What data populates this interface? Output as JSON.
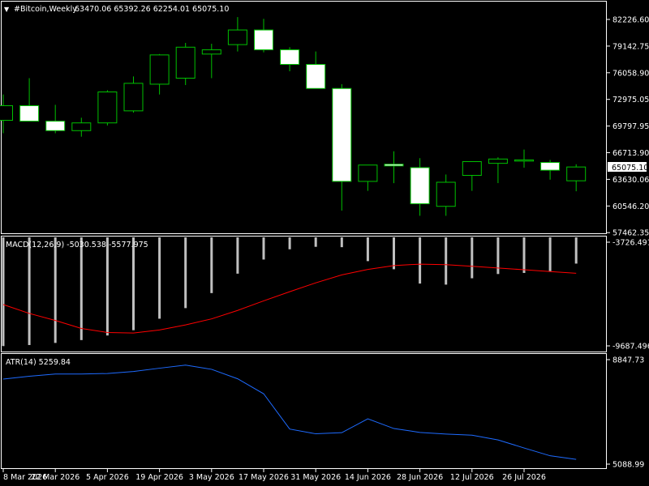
{
  "header": {
    "menu_arrow": "▼",
    "symbol": "#Bitcoin,Weekly",
    "ohlc": "63470.06 65392.26 62254.01 65075.10"
  },
  "macd_header": {
    "label": "MACD(12,26,9) -5030.538 -5577.975"
  },
  "atr_header": {
    "label": "ATR(14) 5259.84"
  },
  "current_price": "65075.10",
  "colors": {
    "background": "#000000",
    "frame": "#ffffff",
    "candle_outline": "#00c000",
    "bull_body": "#000000",
    "bear_body": "#ffffff",
    "macd_hist": "#c0c0c0",
    "macd_signal": "#ff0000",
    "atr_line": "#1e6bff",
    "axis_text": "#ffffff"
  },
  "chart_data": [
    {
      "type": "candlestick",
      "title": "#Bitcoin,Weekly",
      "y_tick_labels": [
        "82226.60",
        "79142.75",
        "76058.90",
        "72975.05",
        "69797.95",
        "66713.90",
        "63630.06",
        "60546.20",
        "57462.35"
      ],
      "ylim": [
        57462.35,
        82226.6
      ],
      "x_tick_labels": [
        "8 Mar 2026",
        "22 Mar 2026",
        "5 Apr 2026",
        "19 Apr 2026",
        "3 May 2026",
        "17 May 2026",
        "31 May 2026",
        "14 Jun 2026",
        "28 Jun 2026",
        "12 Jul 2026",
        "26 Jul 2026"
      ],
      "candles": [
        {
          "o": 70500,
          "h": 73500,
          "l": 69000,
          "c": 72200
        },
        {
          "o": 72200,
          "h": 75400,
          "l": 70700,
          "c": 70400
        },
        {
          "o": 70400,
          "h": 72300,
          "l": 69000,
          "c": 69300
        },
        {
          "o": 69300,
          "h": 70800,
          "l": 68600,
          "c": 70200
        },
        {
          "o": 70200,
          "h": 74000,
          "l": 69900,
          "c": 73800
        },
        {
          "o": 71600,
          "h": 75600,
          "l": 71400,
          "c": 74800
        },
        {
          "o": 74700,
          "h": 78200,
          "l": 73500,
          "c": 78100
        },
        {
          "o": 75400,
          "h": 79500,
          "l": 74600,
          "c": 79000
        },
        {
          "o": 78200,
          "h": 79400,
          "l": 75400,
          "c": 78700
        },
        {
          "o": 79300,
          "h": 82500,
          "l": 78500,
          "c": 81000
        },
        {
          "o": 81000,
          "h": 82300,
          "l": 78400,
          "c": 78700
        },
        {
          "o": 78700,
          "h": 79000,
          "l": 76200,
          "c": 77000
        },
        {
          "o": 77000,
          "h": 78500,
          "l": 74600,
          "c": 74200
        },
        {
          "o": 74200,
          "h": 74700,
          "l": 60000,
          "c": 63400
        },
        {
          "o": 63400,
          "h": 65100,
          "l": 62300,
          "c": 65300
        },
        {
          "o": 65400,
          "h": 66900,
          "l": 63200,
          "c": 65200
        },
        {
          "o": 65000,
          "h": 66100,
          "l": 59400,
          "c": 60800
        },
        {
          "o": 60500,
          "h": 64200,
          "l": 59400,
          "c": 63300
        },
        {
          "o": 64100,
          "h": 65700,
          "l": 62300,
          "c": 65700
        },
        {
          "o": 65500,
          "h": 66200,
          "l": 63200,
          "c": 66000
        },
        {
          "o": 65800,
          "h": 67100,
          "l": 65000,
          "c": 65900
        },
        {
          "o": 65600,
          "h": 65900,
          "l": 63600,
          "c": 64700
        },
        {
          "o": 63470.06,
          "h": 65392.26,
          "l": 62254.01,
          "c": 65075.1
        }
      ]
    },
    {
      "type": "bar",
      "title": "MACD(12,26,9)",
      "y_tick_labels": [
        "-3726.491",
        "-9687.496"
      ],
      "ylim": [
        -9687.496,
        -3726.491
      ],
      "histogram": [
        -9700,
        -9640,
        -9520,
        -9360,
        -9100,
        -8800,
        -8150,
        -7550,
        -6700,
        -5600,
        -4800,
        -4220,
        -4080,
        -4100,
        -4890,
        -5350,
        -6160,
        -6220,
        -5860,
        -5620,
        -5560,
        -5460,
        -5030.538
      ],
      "signal": [
        -7350,
        -7850,
        -8250,
        -8700,
        -8930,
        -8960,
        -8790,
        -8500,
        -8160,
        -7680,
        -7140,
        -6620,
        -6120,
        -5670,
        -5360,
        -5140,
        -5060,
        -5090,
        -5180,
        -5280,
        -5380,
        -5480,
        -5577.975
      ]
    },
    {
      "type": "line",
      "title": "ATR(14)",
      "y_tick_labels": [
        "8847.73",
        "5088.99"
      ],
      "ylim": [
        5088.99,
        8847.73
      ],
      "values": [
        8150,
        8250,
        8330,
        8330,
        8350,
        8420,
        8540,
        8650,
        8500,
        8160,
        7620,
        6350,
        6180,
        6220,
        6720,
        6370,
        6230,
        6170,
        6130,
        5960,
        5670,
        5390,
        5259.84
      ]
    }
  ]
}
